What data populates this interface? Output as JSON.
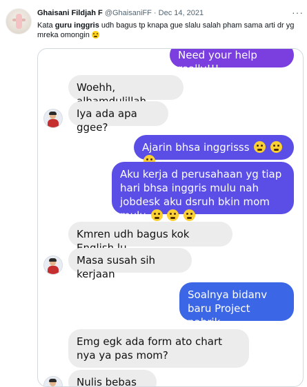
{
  "tweet": {
    "author_name": "Ghaisani Fildjah F",
    "author_handle": "@GhaisaniFF",
    "separator": "·",
    "date": "Dec 14, 2021",
    "text_before": "Kata ",
    "text_bold": "guru inggris",
    "text_after": " udh bagus tp knapa gue slalu salah pham sama arti dr yg mreka omongin",
    "emoji_icon": "crying-face-emoji"
  },
  "chat": {
    "messages": [
      {
        "side": "out",
        "text": "Need your help really!!!",
        "color": "#7b3fe0"
      },
      {
        "side": "in",
        "text": "Woehh, alhamdulillah"
      },
      {
        "side": "in",
        "text": "Iya ada apa ggee?"
      },
      {
        "side": "out",
        "text": "Ajarin bhsa inggrisss",
        "emoji_count": 3,
        "color": "#5a4ee6"
      },
      {
        "side": "out",
        "text": "Aku kerja d perusahaan yg tiap hari bhsa inggris mulu nah jobdesk aku dsruh bkin mom mulu",
        "emoji_count": 3,
        "color": "#5a4ee6"
      },
      {
        "side": "in",
        "text": "Kmren udh bagus kok English lu"
      },
      {
        "side": "in",
        "text": "Masa susah sih kerjaan"
      },
      {
        "side": "out",
        "text": "Soalnya bidanv baru Project pabrik",
        "color": "#3b66e5"
      },
      {
        "side": "in",
        "text": "Emg egk ada form ato chart nya ya pas mom?"
      },
      {
        "side": "in",
        "text": "Nulis bebas gt?"
      }
    ]
  },
  "colors": {
    "bubble_in": "#ececec",
    "bubble_out_purple": "#7b3fe0",
    "bubble_out_indigo": "#5a4ee6",
    "bubble_out_blue": "#3b66e5",
    "muted_text": "#536471"
  }
}
